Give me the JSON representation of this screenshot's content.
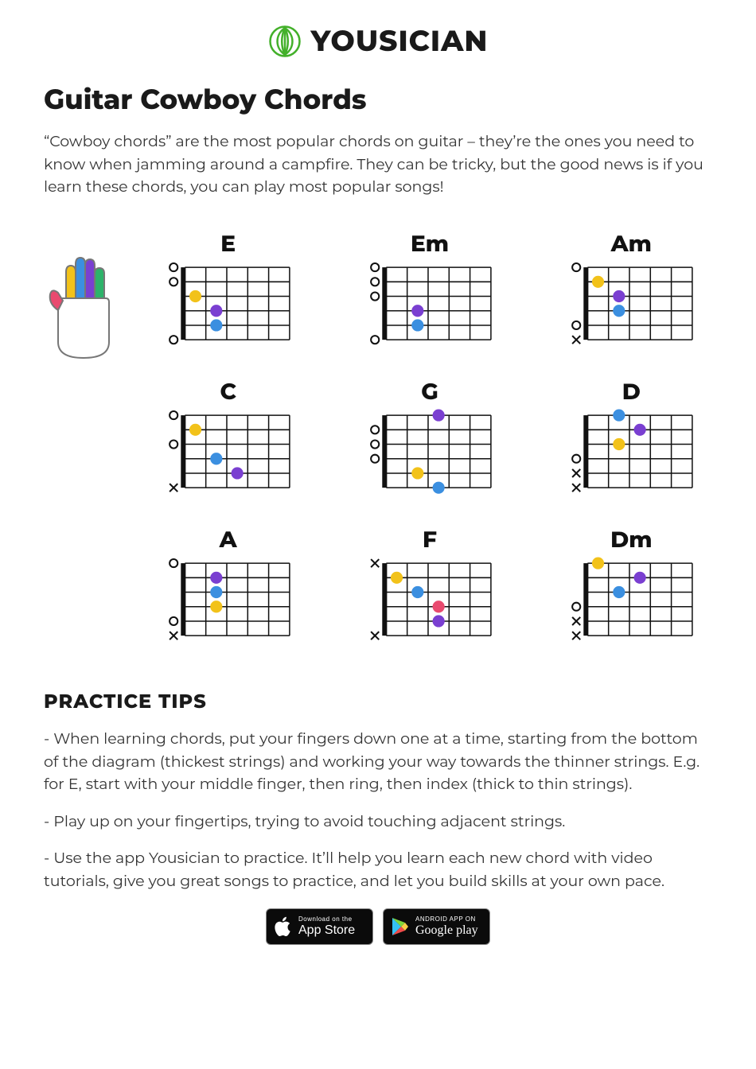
{
  "brand": {
    "name": "YOUSICIAN"
  },
  "title": "Guitar Cowboy Chords",
  "intro": "“Cowboy chords” are the most popular chords on guitar – they’re the ones you need to know when jamming around a campfire. They can be tricky, but the good news is if you learn these chords, you can play most popular songs!",
  "colors": {
    "index": "#f2c21a",
    "middle": "#3b8fe0",
    "ring": "#7a3fd1",
    "pinky": "#2db36a",
    "barre": "#e94a6f"
  },
  "chart_data": [
    {
      "name": "E",
      "strings": [
        {
          "marker": "O"
        },
        {
          "marker": "O"
        },
        {
          "fret": 1,
          "finger": "index"
        },
        {
          "fret": 2,
          "finger": "ring"
        },
        {
          "fret": 2,
          "finger": "middle"
        },
        {
          "marker": "O"
        }
      ]
    },
    {
      "name": "Em",
      "strings": [
        {
          "marker": "O"
        },
        {
          "marker": "O"
        },
        {
          "marker": "O"
        },
        {
          "fret": 2,
          "finger": "ring"
        },
        {
          "fret": 2,
          "finger": "middle"
        },
        {
          "marker": "O"
        }
      ]
    },
    {
      "name": "Am",
      "strings": [
        {
          "marker": "O"
        },
        {
          "fret": 1,
          "finger": "index"
        },
        {
          "fret": 2,
          "finger": "ring"
        },
        {
          "fret": 2,
          "finger": "middle"
        },
        {
          "marker": "O"
        },
        {
          "marker": "X"
        }
      ]
    },
    {
      "name": "C",
      "strings": [
        {
          "marker": "O"
        },
        {
          "fret": 1,
          "finger": "index"
        },
        {
          "marker": "O"
        },
        {
          "fret": 2,
          "finger": "middle"
        },
        {
          "fret": 3,
          "finger": "ring"
        },
        {
          "marker": "X"
        }
      ]
    },
    {
      "name": "G",
      "strings": [
        {
          "fret": 3,
          "finger": "ring"
        },
        {
          "marker": "O"
        },
        {
          "marker": "O"
        },
        {
          "marker": "O"
        },
        {
          "fret": 2,
          "finger": "index"
        },
        {
          "fret": 3,
          "finger": "middle"
        }
      ]
    },
    {
      "name": "D",
      "strings": [
        {
          "fret": 2,
          "finger": "middle"
        },
        {
          "fret": 3,
          "finger": "ring"
        },
        {
          "fret": 2,
          "finger": "index"
        },
        {
          "marker": "O"
        },
        {
          "marker": "X"
        },
        {
          "marker": "X"
        }
      ]
    },
    {
      "name": "A",
      "strings": [
        {
          "marker": "O"
        },
        {
          "fret": 2,
          "finger": "ring"
        },
        {
          "fret": 2,
          "finger": "middle"
        },
        {
          "fret": 2,
          "finger": "index"
        },
        {
          "marker": "O"
        },
        {
          "marker": "X"
        }
      ]
    },
    {
      "name": "F",
      "strings": [
        {
          "marker": "X"
        },
        {
          "fret": 1,
          "finger": "index"
        },
        {
          "fret": 2,
          "finger": "middle"
        },
        {
          "fret": 3,
          "finger": "barre"
        },
        {
          "fret": 3,
          "finger": "ring"
        },
        {
          "marker": "X"
        }
      ]
    },
    {
      "name": "Dm",
      "strings": [
        {
          "fret": 1,
          "finger": "index"
        },
        {
          "fret": 3,
          "finger": "ring"
        },
        {
          "fret": 2,
          "finger": "middle"
        },
        {
          "marker": "O"
        },
        {
          "marker": "X"
        },
        {
          "marker": "X"
        }
      ]
    }
  ],
  "sections": {
    "tips_title": "PRACTICE TIPS",
    "tips": [
      "- When learning chords, put your fingers down one at a time, starting from the bottom of the diagram (thickest strings) and working your way towards the thinner strings. E.g. for E, start with your middle finger, then ring, then index (thick to thin strings).",
      "- Play up on your fingertips, trying to avoid touching adjacent strings.",
      "- Use the app Yousician to practice. It’ll help you learn each new chord with video tutorials, give you great songs to practice, and let you build skills at your own pace."
    ]
  },
  "store": {
    "apple_line1": "Download on the",
    "apple_line2": "App Store",
    "google_line1": "ANDROID APP ON",
    "google_line2": "Google play"
  }
}
